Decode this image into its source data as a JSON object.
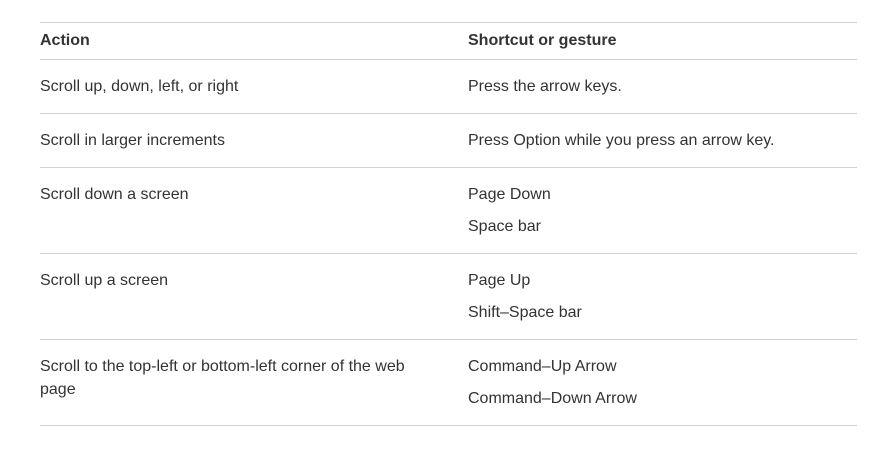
{
  "table": {
    "headers": [
      "Action",
      "Shortcut or gesture"
    ],
    "rows": [
      {
        "action": "Scroll up, down, left, or right",
        "shortcuts": [
          "Press the arrow keys."
        ]
      },
      {
        "action": "Scroll in larger increments",
        "shortcuts": [
          "Press Option while you press an arrow key."
        ]
      },
      {
        "action": "Scroll down a screen",
        "shortcuts": [
          "Page Down",
          "Space bar"
        ]
      },
      {
        "action": "Scroll up a screen",
        "shortcuts": [
          "Page Up",
          "Shift–Space bar"
        ]
      },
      {
        "action": "Scroll to the top-left or bottom-left corner of the web page",
        "shortcuts": [
          "Command–Up Arrow",
          "Command–Down Arrow"
        ]
      }
    ]
  }
}
